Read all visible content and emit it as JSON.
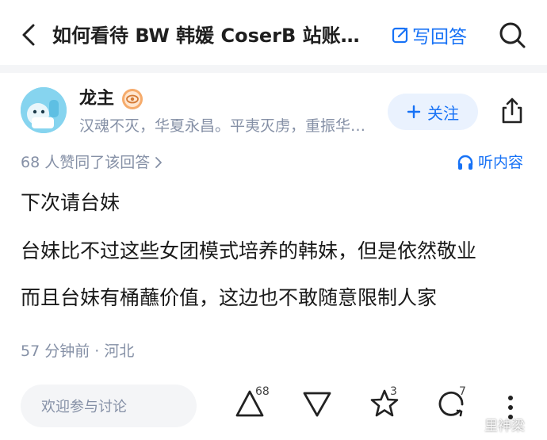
{
  "header": {
    "title": "如何看待 BW 韩媛 CoserB 站账号开通弹幕功能的事件？",
    "write_answer": "写回答",
    "icons": [
      "back-arrow-icon",
      "edit-icon",
      "search-icon"
    ]
  },
  "author": {
    "name": "龙主",
    "bio": "汉魂不灭，华夏永昌。平夷灭虏，重振华夏雄风",
    "follow_label": "关注",
    "badge_icon": "eye-badge-icon",
    "share_icon": "share-icon"
  },
  "answer": {
    "likes_text": "68 人赞同了该回答",
    "listen_label": "听内容",
    "paragraphs": [
      "下次请台妹",
      "台妹比不过这些女团模式培养的韩妹，但是依然敬业",
      "而且台妹有桶蘸价值，这边也不敢随意限制人家"
    ],
    "meta": "57 分钟前 · 河北"
  },
  "footer": {
    "comment_placeholder": "欢迎参与讨论",
    "upvote_count": "68",
    "favorite_count": "3",
    "comment_count": "7",
    "watermark": "里神梁"
  },
  "colors": {
    "accent": "#1772f6",
    "muted": "#8590a6",
    "follow_bg": "#eaf2fe",
    "input_bg": "#f4f5f7"
  }
}
